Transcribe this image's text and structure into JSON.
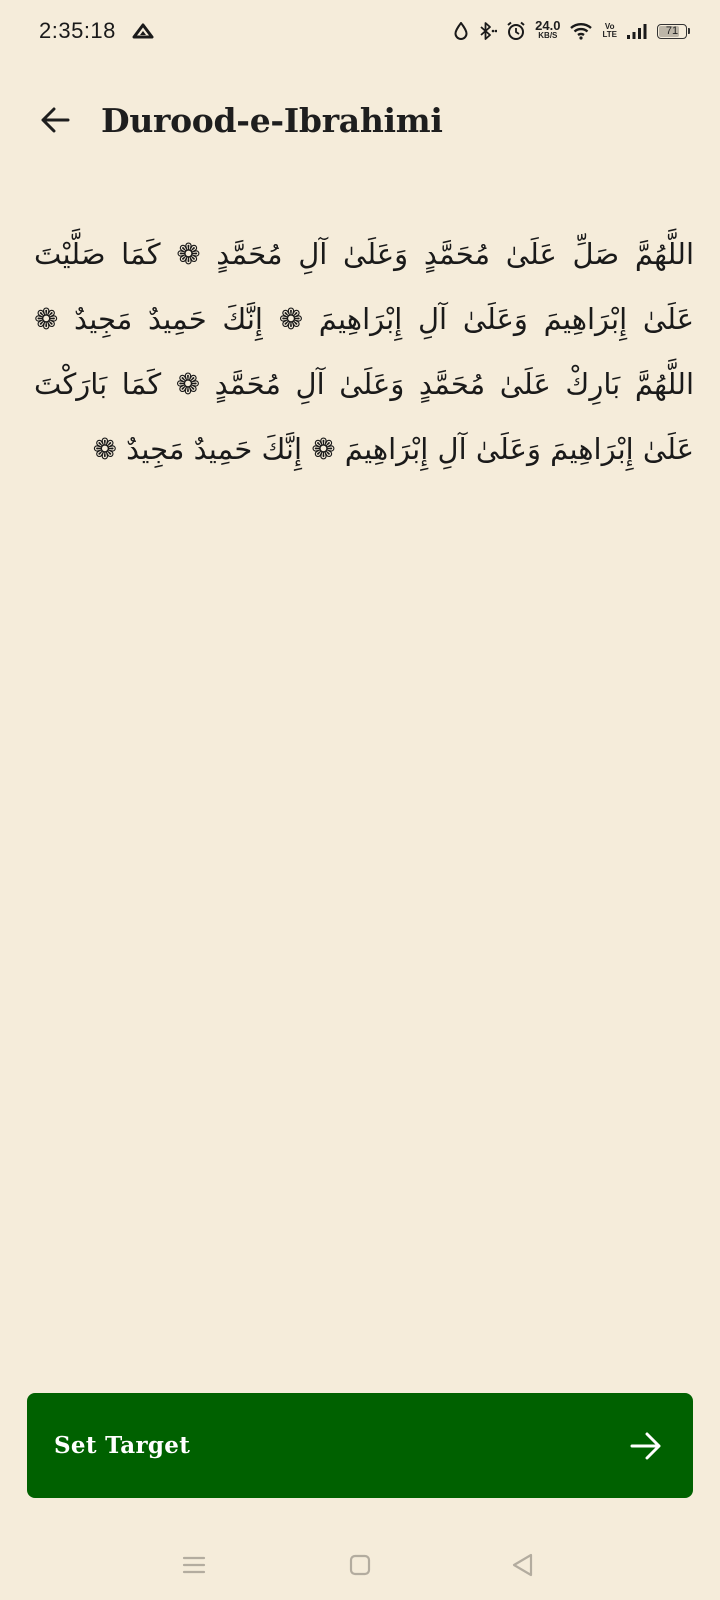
{
  "status_bar": {
    "time": "2:35:18",
    "net_speed_value": "24.0",
    "net_speed_unit": "KB/S",
    "volte_top": "Vo",
    "volte_bottom": "LTE",
    "battery_level": "71",
    "icons": [
      "triangle-alert-icon",
      "drop-icon",
      "bluetooth-icon",
      "alarm-icon",
      "wifi-icon",
      "signal-icon",
      "battery-icon"
    ]
  },
  "app_bar": {
    "back_icon": "arrow-left-icon",
    "title": "Durood-e-Ibrahimi"
  },
  "content": {
    "arabic": "اللَّهُمَّ صَلِّ عَلَىٰ مُحَمَّدٍ وَعَلَىٰ آلِ مُحَمَّدٍ ❁ كَمَا صَلَّيْتَ عَلَىٰ إِبْرَاهِيمَ وَعَلَىٰ آلِ إِبْرَاهِيمَ ❁ إِنَّكَ حَمِيدٌ مَجِيدٌ ❁ اللَّهُمَّ بَارِكْ عَلَىٰ مُحَمَّدٍ وَعَلَىٰ آلِ مُحَمَّدٍ ❁ كَمَا بَارَكْتَ عَلَىٰ إِبْرَاهِيمَ وَعَلَىٰ آلِ إِبْرَاهِيمَ ❁ إِنَّكَ حَمِيدٌ مَجِيدٌ ❁"
  },
  "cta": {
    "label": "Set Target",
    "icon": "arrow-right-icon"
  },
  "nav_bar": {
    "icons": [
      "menu-icon",
      "home-square-icon",
      "back-triangle-icon"
    ]
  },
  "colors": {
    "background": "#f5ecda",
    "cta_background": "#006100",
    "cta_text": "#ffffff",
    "text": "#1f1f1f"
  }
}
